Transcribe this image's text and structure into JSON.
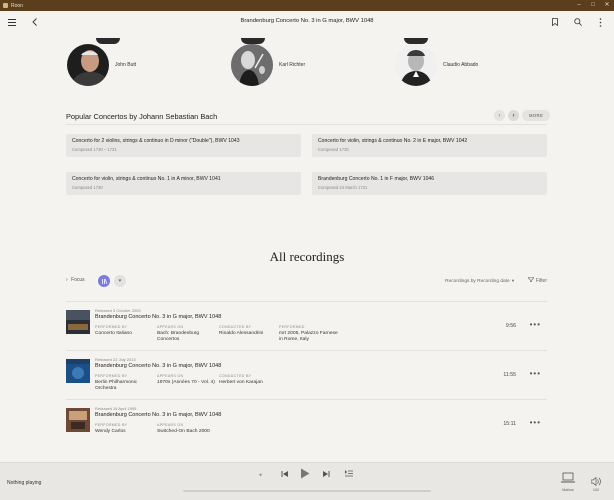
{
  "window": {
    "title": "Roon"
  },
  "header": {
    "title": "Brandenburg Concerto No. 3 in G major, BWV 1048"
  },
  "artists": [
    {
      "name": "John Butt"
    },
    {
      "name": "Karl Richter"
    },
    {
      "name": "Claudio Abbado"
    }
  ],
  "popular": {
    "title": "Popular Concertos by Johann Sebastian Bach",
    "more_label": "MORE",
    "items": [
      {
        "title": "Concerto for 2 violins, strings & continuo in D minor (\"Double\"), BWV 1043",
        "composed": "Composed 1730 – 1731"
      },
      {
        "title": "Concerto for violin, strings & continuo No. 2 in E major, BWV 1042",
        "composed": "Composed 1730"
      },
      {
        "title": "Concerto for violin, strings & continuo No. 1 in A minor, BWV 1041",
        "composed": "Composed 1730"
      },
      {
        "title": "Brandenburg Concerto No. 1 in F major, BWV 1046",
        "composed": "Composed 24 March 1721"
      }
    ]
  },
  "recordings": {
    "heading": "All recordings",
    "focus_label": "Focus",
    "sort_label": "Recordings by Recording date",
    "filter_label": "Filter",
    "labels": {
      "performed_by": "PERFORMED BY",
      "appears_on": "APPEARS ON",
      "conducted_by": "CONDUCTED BY",
      "performed": "PERFORMED"
    },
    "items": [
      {
        "released": "Released 3 October 2005",
        "title": "Brandenburg Concerto No. 3 in G major, BWV 1048",
        "performed_by": "Concerto Italiano",
        "appears_on": "Bach: Brandenburg Concertos",
        "conducted_by": "Rinaldo Alessandrini",
        "performed": "mrt 2005, Palazzo Farnese in Rome, Italy",
        "duration": "9:56"
      },
      {
        "released": "Released 22 July 2013",
        "title": "Brandenburg Concerto No. 3 in G major, BWV 1048",
        "performed_by": "Berlin Philharmonic Orchestra",
        "appears_on": "1970s (Années 70 - Vol. 4)",
        "conducted_by": "Herbert von Karajan",
        "duration": "11:55"
      },
      {
        "released": "Released 16 April 1995",
        "title": "Brandenburg Concerto No. 3 in G major, BWV 1048",
        "performed_by": "Wendy Carlos",
        "appears_on": "Switched-On Bach 2000",
        "duration": "15:11"
      }
    ]
  },
  "player": {
    "now_playing": "Nothing playing",
    "zone": "Mallow",
    "volume": "100"
  },
  "colors": {
    "accent": "#7b7be0",
    "titlebar": "#5b3f1d"
  },
  "icons": [
    "menu-icon",
    "back-icon",
    "bookmark-icon",
    "search-icon",
    "more-vertical-icon",
    "chevron-left-icon",
    "chevron-right-icon",
    "heart-icon",
    "filter-icon",
    "shuffle-icon",
    "previous-icon",
    "play-icon",
    "next-icon",
    "queue-icon",
    "laptop-icon",
    "volume-icon"
  ]
}
